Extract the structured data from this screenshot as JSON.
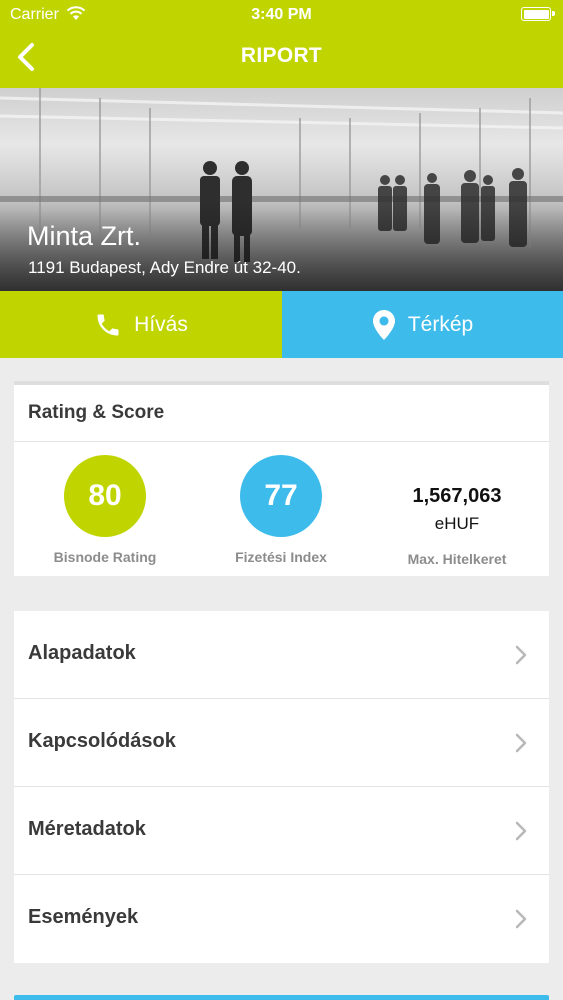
{
  "status_bar": {
    "carrier": "Carrier",
    "time": "3:40 PM"
  },
  "nav": {
    "title": "RIPORT",
    "back_icon": "chevron-left-icon"
  },
  "hero": {
    "company_name": "Minta Zrt.",
    "address": "1191 Budapest, Ady Endre út 32-40."
  },
  "actions": {
    "call": {
      "label": "Hívás",
      "icon": "phone-icon",
      "color": "#c0d500"
    },
    "map": {
      "label": "Térkép",
      "icon": "map-pin-icon",
      "color": "#3dbbea"
    }
  },
  "rating": {
    "title": "Rating & Score",
    "bisnode": {
      "value": "80",
      "label": "Bisnode Rating"
    },
    "payment": {
      "value": "77",
      "label": "Fizetési Index"
    },
    "credit": {
      "value": "1,567,063",
      "unit": "eHUF",
      "label": "Max. Hitelkeret"
    }
  },
  "menu": {
    "items": [
      {
        "label": "Alapadatok"
      },
      {
        "label": "Kapcsolódások"
      },
      {
        "label": "Méretadatok"
      },
      {
        "label": "Események"
      }
    ]
  },
  "colors": {
    "accent_green": "#c0d500",
    "accent_blue": "#3dbbea",
    "background": "#ececec"
  }
}
